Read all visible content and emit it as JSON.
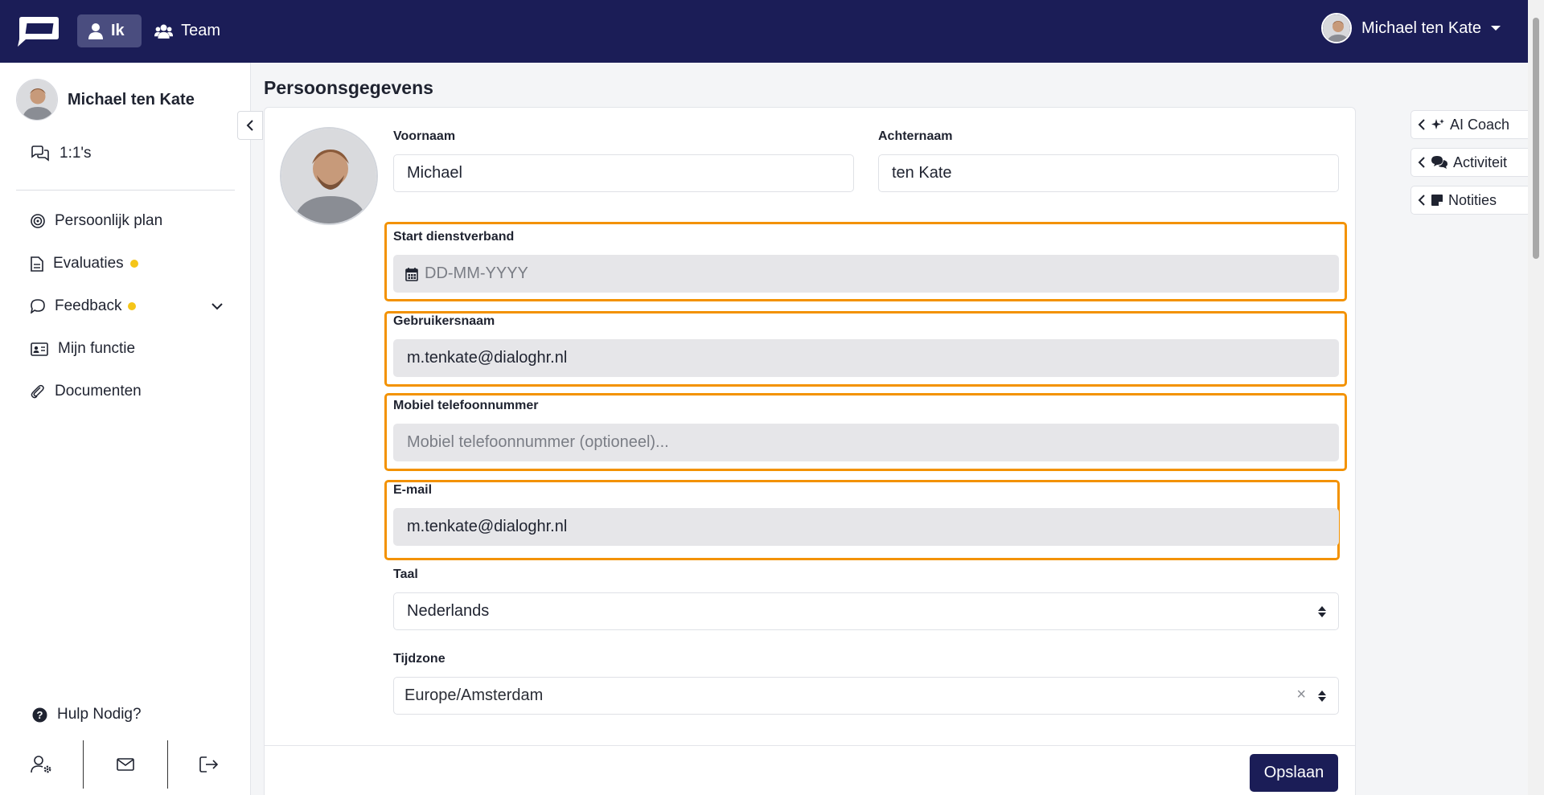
{
  "topbar": {
    "nav_me": "Ik",
    "nav_team": "Team",
    "user_name": "Michael ten Kate"
  },
  "sidebar": {
    "profile_name": "Michael ten Kate",
    "oneone": "1:1's",
    "items": [
      {
        "label": "Persoonlijk plan",
        "icon": "target-icon"
      },
      {
        "label": "Evaluaties",
        "icon": "document-icon",
        "badge": true
      },
      {
        "label": "Feedback",
        "icon": "chat-bubble-icon",
        "badge": true,
        "expandable": true
      },
      {
        "label": "Mijn functie",
        "icon": "id-card-icon"
      },
      {
        "label": "Documenten",
        "icon": "paperclip-icon"
      }
    ],
    "help": "Hulp Nodig?"
  },
  "main": {
    "title": "Persoonsgegevens",
    "first_name_label": "Voornaam",
    "first_name_value": "Michael",
    "last_name_label": "Achternaam",
    "last_name_value": "ten Kate",
    "start_label": "Start dienstverband",
    "start_placeholder": "DD-MM-YYYY",
    "username_label": "Gebruikersnaam",
    "username_value": "m.tenkate@dialoghr.nl",
    "mobile_label": "Mobiel telefoonnummer",
    "mobile_placeholder": "Mobiel telefoonnummer (optioneel)...",
    "email_label": "E-mail",
    "email_value": "m.tenkate@dialoghr.nl",
    "language_label": "Taal",
    "language_value": "Nederlands",
    "timezone_label": "Tijdzone",
    "timezone_value": "Europe/Amsterdam",
    "save_label": "Opslaan"
  },
  "right_panel": {
    "tabs": [
      "AI Coach",
      "Activiteit",
      "Notities"
    ]
  },
  "colors": {
    "brand": "#1b1d57",
    "highlight": "#f39200",
    "badge": "#f5c518"
  }
}
